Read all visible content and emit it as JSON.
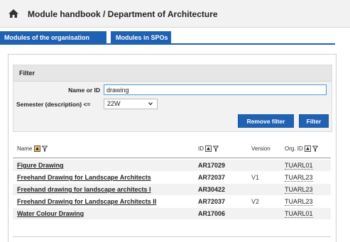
{
  "header": {
    "home_icon": "home-icon",
    "breadcrumb": "Module handbook / Department of Architecture"
  },
  "tabs": [
    {
      "label": "Modules of the organisation",
      "active": true
    },
    {
      "label": "Modules in SPOs",
      "active": false
    }
  ],
  "filter": {
    "title": "Filter",
    "name_label": "Name or ID",
    "name_value": "drawing",
    "semester_label": "Semester (description) <=",
    "semester_value": "22W",
    "remove_label": "Remove filter",
    "apply_label": "Filter"
  },
  "table": {
    "headers": {
      "name": "Name",
      "id": "ID",
      "version": "Version",
      "org": "Org. ID"
    },
    "rows": [
      {
        "name": "Figure Drawing",
        "id": "AR17029",
        "version": "",
        "org": "TUARL01"
      },
      {
        "name": "Freehand Drawing for Landscape Architects",
        "id": "AR72037",
        "version": "V1",
        "org": "TUARL23"
      },
      {
        "name": "Freehand drawing for landscape architects I",
        "id": "AR30422",
        "version": "",
        "org": "TUARL23"
      },
      {
        "name": "Freehand Drawing for Landscape Architects II",
        "id": "AR72037",
        "version": "V2",
        "org": "TUARL23"
      },
      {
        "name": "Water Colour Drawing",
        "id": "AR17006",
        "version": "",
        "org": "TUARL01"
      }
    ]
  },
  "colors": {
    "accent": "#1f62b4",
    "header_bg": "#f2f2f2",
    "filter_bg": "#f2f2f2",
    "row_alt": "#f2f2f2"
  }
}
